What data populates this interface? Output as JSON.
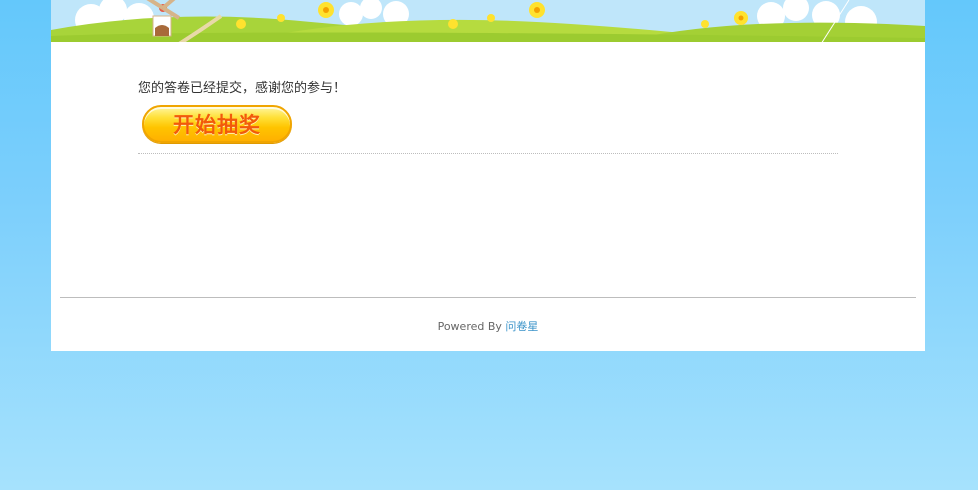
{
  "survey_complete": {
    "message": "您的答卷已经提交，感谢您的参与！",
    "lottery_button_label": "开始抽奖"
  },
  "footer": {
    "powered_by": "Powered By",
    "brand_link": "问卷星"
  },
  "colors": {
    "page_background": "#7ccffc",
    "card_background": "#ffffff",
    "button_fill": "#ffc400",
    "button_text": "#f25a0a",
    "link": "#3a93c9"
  }
}
